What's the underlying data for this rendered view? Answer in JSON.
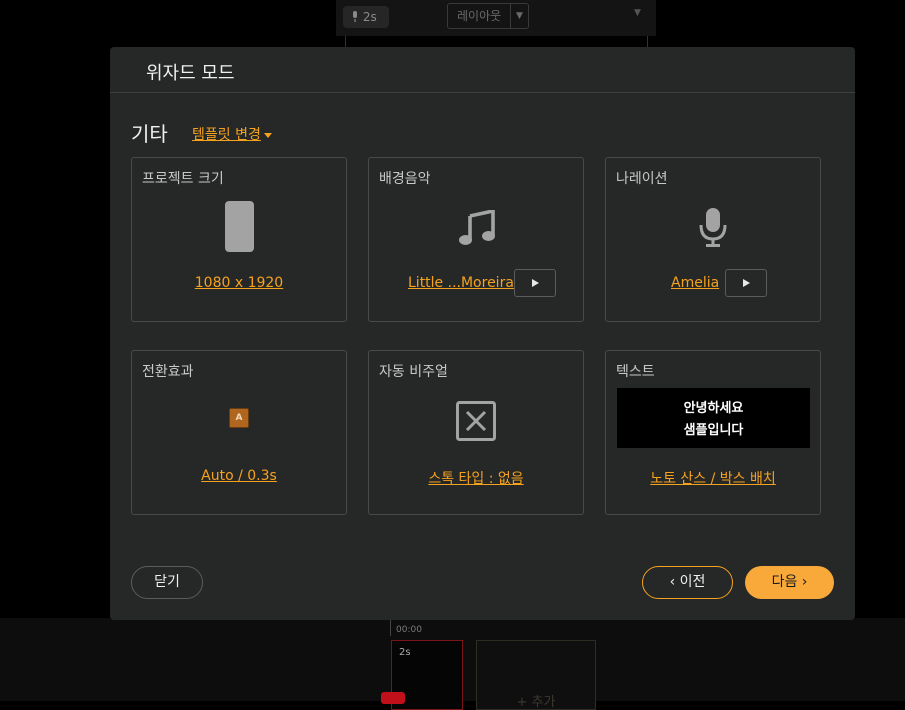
{
  "background": {
    "toolbar": {
      "mic_duration": "2s",
      "layout_label": "레이아웃"
    },
    "timeline": {
      "time_marker": "00:00",
      "clip_duration": "2s",
      "add_label": "+ 추가"
    }
  },
  "modal": {
    "title": "위자드 모드",
    "section_title": "기타",
    "template_link": "템플릿 변경",
    "cards": {
      "project_size": {
        "label": "프로젝트 크기",
        "value": "1080 x 1920"
      },
      "bgm": {
        "label": "배경음악",
        "value": "Little ...Moreira"
      },
      "narration": {
        "label": "나레이션",
        "value": "Amelia"
      },
      "transition": {
        "label": "전환효과",
        "value": "Auto / 0.3s",
        "icon_text": "A"
      },
      "auto_visual": {
        "label": "자동 비주얼",
        "value": "스톡 타입 : 없음"
      },
      "text": {
        "label": "텍스트",
        "preview_line1": "안녕하세요",
        "preview_line2": "샘플입니다",
        "value": "노토 산스 / 박스 배치"
      }
    },
    "buttons": {
      "close": "닫기",
      "prev": "이전",
      "next": "다음"
    }
  },
  "colors": {
    "accent": "#f5a21e",
    "next_button": "#f8a93a",
    "modal_bg": "#262828",
    "card_border": "#474a4a"
  },
  "icons": [
    "microphone-icon",
    "music-note-icon",
    "play-icon",
    "x-box-icon",
    "chevron-left-icon",
    "chevron-right-icon"
  ]
}
